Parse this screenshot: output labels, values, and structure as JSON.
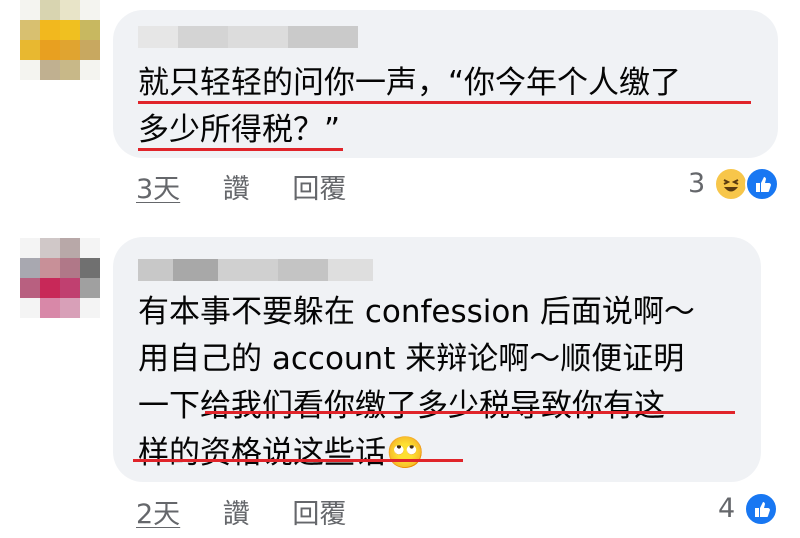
{
  "comments": [
    {
      "text_lines": [
        "就只轻轻的问你一声，“你今年个人缴了",
        "多少所得税？”"
      ],
      "actions": {
        "time": "3天",
        "reply_alt": "讚",
        "reply": "回覆"
      },
      "reaction_count": "3",
      "reactions": [
        "haha",
        "like"
      ]
    },
    {
      "text_lines": [
        "有本事不要躲在 confession 后面说啊～",
        "用自己的 account 来辩论啊～顺便证明",
        "一下给我们看你缴了多少税导致你有这",
        "样的资格说这些话🙄"
      ],
      "actions": {
        "time": "2天",
        "reply_alt": "讚",
        "reply": "回覆"
      },
      "reaction_count": "4",
      "reactions": [
        "like"
      ]
    }
  ],
  "colors": {
    "underline": "#e0242a",
    "bubble": "#f0f2f5",
    "like": "#1877f2"
  }
}
